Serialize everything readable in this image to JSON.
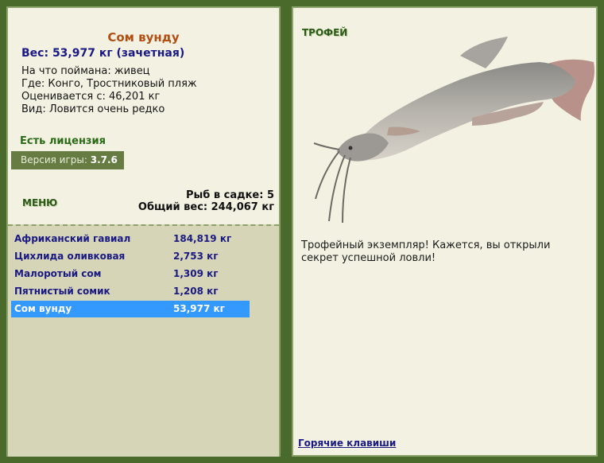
{
  "fish": {
    "title": "Сом вунду",
    "weight_line": "Вес: 53,977 кг (зачетная)",
    "bait_line": "На что поймана: живец",
    "place_line": "Где: Конго, Тростниковый пляж",
    "value_line": "Оценивается с: 46,201 кг",
    "kind_line": "Вид: Ловится очень редко"
  },
  "license": "Есть лицензия",
  "version": {
    "label": "Версия игры:",
    "value": "3.7.6"
  },
  "menu": {
    "title": "МЕНЮ",
    "cage_count": "Рыб в садке: 5",
    "total_weight": "Общий вес: 244,067 кг"
  },
  "cage_list": [
    {
      "name": "Африканский гавиал",
      "weight": "184,819 кг"
    },
    {
      "name": "Цихлида оливковая",
      "weight": "2,753 кг"
    },
    {
      "name": "Малоротый сом",
      "weight": "1,309 кг"
    },
    {
      "name": "Пятнистый сомик",
      "weight": "1,208 кг"
    },
    {
      "name": "Сом вунду",
      "weight": "53,977 кг"
    }
  ],
  "trophy": {
    "title": "ТРОФЕЙ",
    "image_icon": "catfish-image",
    "text": "Трофейный экземпляр! Кажется, вы открыли секрет успешной ловли!"
  },
  "hotkeys": "Горячие клавиши"
}
